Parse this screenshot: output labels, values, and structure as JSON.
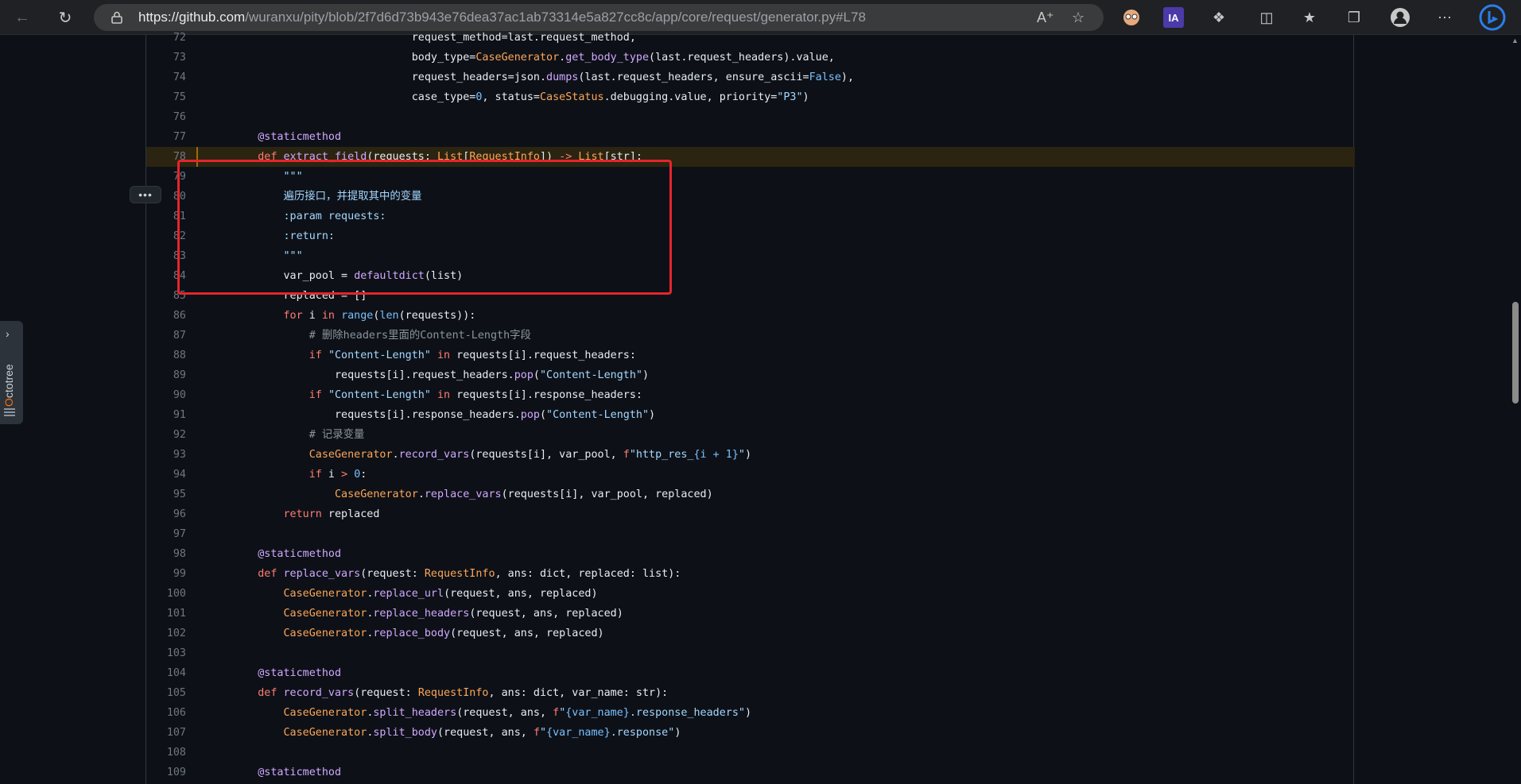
{
  "browser": {
    "url_host": "https://github.com",
    "url_path": "/wuranxu/pity/blob/2f7d6d73b943e76dea37ac1ab73314e5a827cc8c/app/core/request/generator.py#L78",
    "ia_label": "IA"
  },
  "octotree": {
    "label_first": "O",
    "label_rest": "ctotree"
  },
  "kebab_label": "•••",
  "code_lines": [
    {
      "n": "72",
      "html": "                            request_method=last.request_method,"
    },
    {
      "n": "73",
      "html": "                            body_type=<span class=\"c\">CaseGenerator</span>.<span class=\"f\">get_body_type</span>(last.request_headers).value,"
    },
    {
      "n": "74",
      "html": "                            request_headers=json.<span class=\"f\">dumps</span>(last.request_headers, ensure_ascii=<span class=\"n\">False</span>),"
    },
    {
      "n": "75",
      "html": "                            case_type=<span class=\"n\">0</span>, status=<span class=\"c\">CaseStatus</span>.debugging.value, priority=<span class=\"s\">\"P3\"</span>)"
    },
    {
      "n": "76",
      "html": ""
    },
    {
      "n": "77",
      "html": "    <span class=\"f\">@staticmethod</span>"
    },
    {
      "n": "78",
      "html": "    <span class=\"k\">def</span> <span class=\"f\">extract_field</span>(requests: <span class=\"c\">List</span>[<span class=\"c\">RequestInfo</span>]) <span class=\"k\">-&gt;</span> <span class=\"c\">List</span>[str]:",
      "hl": true
    },
    {
      "n": "79",
      "html": "        <span class=\"s\">\"\"\"</span>"
    },
    {
      "n": "80",
      "html": "<span class=\"s\">        遍历接口，并提取其中的变量</span>"
    },
    {
      "n": "81",
      "html": "<span class=\"s\">        :param requests:</span>"
    },
    {
      "n": "82",
      "html": "<span class=\"s\">        :return:</span>"
    },
    {
      "n": "83",
      "html": "<span class=\"s\">        \"\"\"</span>"
    },
    {
      "n": "84",
      "html": "        var_pool = <span class=\"f\">defaultdict</span>(list)"
    },
    {
      "n": "85",
      "html": "        replaced = []"
    },
    {
      "n": "86",
      "html": "        <span class=\"k\">for</span> i <span class=\"k\">in</span> <span class=\"n\">range</span>(<span class=\"n\">len</span>(requests)):"
    },
    {
      "n": "87",
      "html": "            <span class=\"cm\"># 删除headers里面的Content-Length字段</span>"
    },
    {
      "n": "88",
      "html": "            <span class=\"k\">if</span> <span class=\"s\">\"Content-Length\"</span> <span class=\"k\">in</span> requests[i].request_headers:"
    },
    {
      "n": "89",
      "html": "                requests[i].request_headers.<span class=\"f\">pop</span>(<span class=\"s\">\"Content-Length\"</span>)"
    },
    {
      "n": "90",
      "html": "            <span class=\"k\">if</span> <span class=\"s\">\"Content-Length\"</span> <span class=\"k\">in</span> requests[i].response_headers:"
    },
    {
      "n": "91",
      "html": "                requests[i].response_headers.<span class=\"f\">pop</span>(<span class=\"s\">\"Content-Length\"</span>)"
    },
    {
      "n": "92",
      "html": "            <span class=\"cm\"># 记录变量</span>"
    },
    {
      "n": "93",
      "html": "            <span class=\"c\">CaseGenerator</span>.<span class=\"f\">record_vars</span>(requests[i], var_pool, <span class=\"k\">f</span><span class=\"s\">\"http_res_</span><span class=\"n\">{i + 1}</span><span class=\"s\">\"</span>)"
    },
    {
      "n": "94",
      "html": "            <span class=\"k\">if</span> i <span class=\"k\">&gt;</span> <span class=\"n\">0</span>:"
    },
    {
      "n": "95",
      "html": "                <span class=\"c\">CaseGenerator</span>.<span class=\"f\">replace_vars</span>(requests[i], var_pool, replaced)"
    },
    {
      "n": "96",
      "html": "        <span class=\"k\">return</span> replaced"
    },
    {
      "n": "97",
      "html": ""
    },
    {
      "n": "98",
      "html": "    <span class=\"f\">@staticmethod</span>"
    },
    {
      "n": "99",
      "html": "    <span class=\"k\">def</span> <span class=\"f\">replace_vars</span>(request: <span class=\"c\">RequestInfo</span>, ans: dict, replaced: list):"
    },
    {
      "n": "100",
      "html": "        <span class=\"c\">CaseGenerator</span>.<span class=\"f\">replace_url</span>(request, ans, replaced)"
    },
    {
      "n": "101",
      "html": "        <span class=\"c\">CaseGenerator</span>.<span class=\"f\">replace_headers</span>(request, ans, replaced)"
    },
    {
      "n": "102",
      "html": "        <span class=\"c\">CaseGenerator</span>.<span class=\"f\">replace_body</span>(request, ans, replaced)"
    },
    {
      "n": "103",
      "html": ""
    },
    {
      "n": "104",
      "html": "    <span class=\"f\">@staticmethod</span>"
    },
    {
      "n": "105",
      "html": "    <span class=\"k\">def</span> <span class=\"f\">record_vars</span>(request: <span class=\"c\">RequestInfo</span>, ans: dict, var_name: str):"
    },
    {
      "n": "106",
      "html": "        <span class=\"c\">CaseGenerator</span>.<span class=\"f\">split_headers</span>(request, ans, <span class=\"k\">f</span><span class=\"s\">\"</span><span class=\"n\">{var_name}</span><span class=\"s\">.response_headers\"</span>)"
    },
    {
      "n": "107",
      "html": "        <span class=\"c\">CaseGenerator</span>.<span class=\"f\">split_body</span>(request, ans, <span class=\"k\">f</span><span class=\"s\">\"</span><span class=\"n\">{var_name}</span><span class=\"s\">.response\"</span>)"
    },
    {
      "n": "108",
      "html": ""
    },
    {
      "n": "109",
      "html": "    <span class=\"f\">@staticmethod</span>"
    }
  ]
}
